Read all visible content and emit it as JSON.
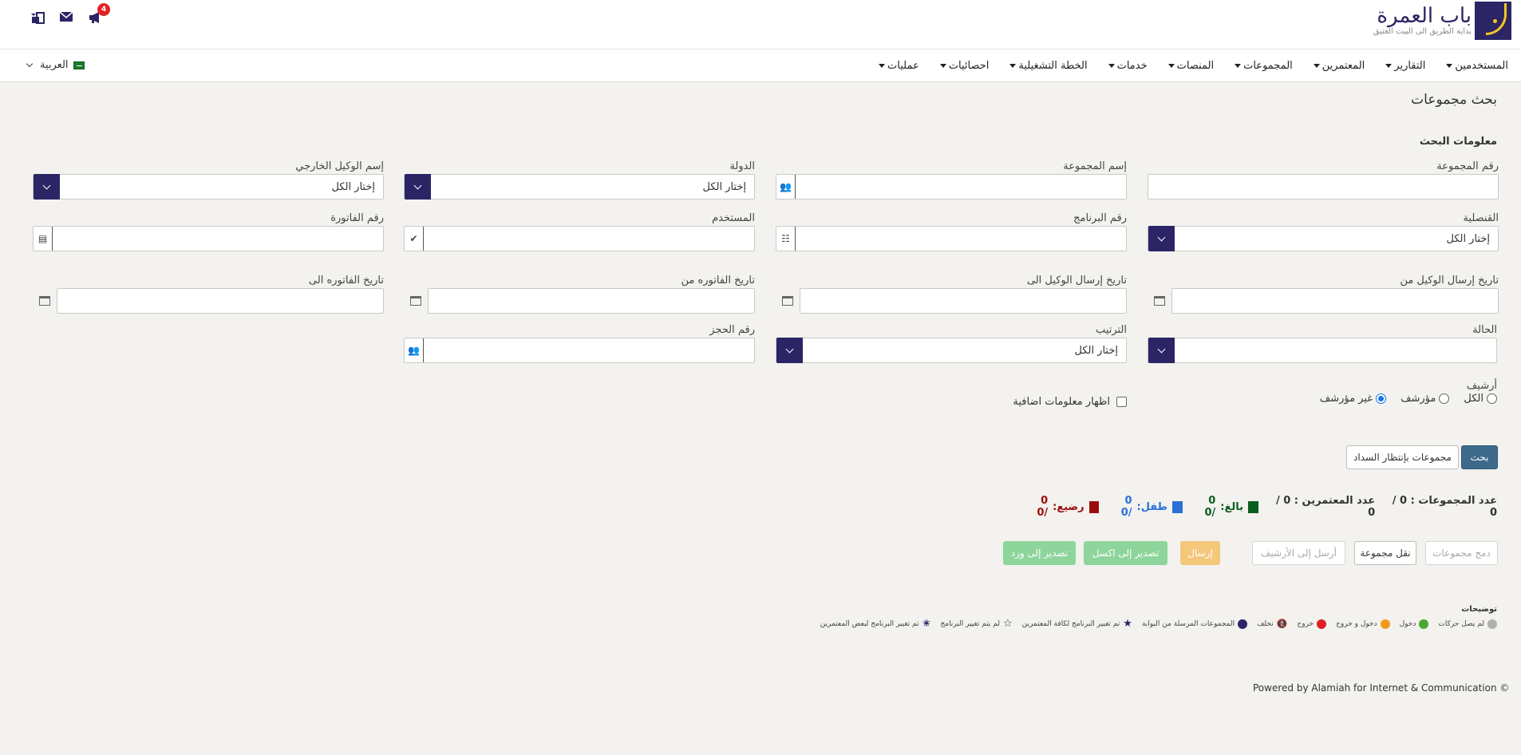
{
  "header": {
    "logo_title": "باب العمرة",
    "logo_subtitle": "بداية الطريق الى البيت العتيق",
    "notification_count": "4"
  },
  "nav": {
    "items": [
      "المستخدمين",
      "التقارير",
      "المعتمرين",
      "المجموعات",
      "المنصات",
      "خدمات",
      "الخطة التشغيلية",
      "احصائيات",
      "عمليات"
    ],
    "language": "العربية"
  },
  "page": {
    "title": "بحث مجموعات",
    "section": "معلومات البحث"
  },
  "form": {
    "group_number": {
      "label": "رقم المجموعة",
      "value": ""
    },
    "group_name": {
      "label": "إسم المجموعة",
      "value": ""
    },
    "country": {
      "label": "الدولة",
      "value": "إختار الكل"
    },
    "external_agent": {
      "label": "إسم الوكيل الخارجي",
      "value": "إختار الكل"
    },
    "consulate": {
      "label": "القنصلية",
      "value": "إختار الكل"
    },
    "program_number": {
      "label": "رقم البرنامج",
      "value": ""
    },
    "user": {
      "label": "المستخدم",
      "value": ""
    },
    "invoice_number": {
      "label": "رقم الفاتورة",
      "value": ""
    },
    "agent_send_from": {
      "label": "تاريخ إرسال الوكيل من",
      "value": ""
    },
    "agent_send_to": {
      "label": "تاريخ إرسال الوكيل الى",
      "value": ""
    },
    "invoice_date_from": {
      "label": "تاريخ الفاتوره من",
      "value": ""
    },
    "invoice_date_to": {
      "label": "تاريخ الفاتوره الى",
      "value": ""
    },
    "status": {
      "label": "الحالة",
      "value": ""
    },
    "sort": {
      "label": "الترتيب",
      "value": "إختار الكل"
    },
    "booking_number": {
      "label": "رقم الحجز",
      "value": ""
    },
    "archive": {
      "label": "أرشيف",
      "options": [
        "الكل",
        "مؤرشف",
        "غير مؤرشف"
      ],
      "selected": "غير مؤرشف"
    },
    "extra_info_label": "اظهار معلومات اضافية"
  },
  "actions": {
    "search": "بحث",
    "pending_payment": "مجموعات بإنتظار السداد",
    "merge": "دمج مجموعات",
    "move": "نقل مجموعة",
    "archive": "أرسل إلى الأرشيف",
    "send": "إرسال",
    "export_excel": "تصدير إلى اكسل",
    "export_word": "تصدير إلى ورد"
  },
  "stats": {
    "groups_label": "عدد المجموعات :",
    "groups_value": "0 / 0",
    "pilgrims_label": "عدد المعتمرين :",
    "pilgrims_value": "0 / 0",
    "adult_label": "بالغ:",
    "adult_value": "0 /0",
    "child_label": "طفل:",
    "child_value": "0 /0",
    "infant_label": "رضيع:",
    "infant_value": "0 /0",
    "colors": {
      "adult": "#0b5d1e",
      "child": "#2b6fd8",
      "infant": "#9b0d0d"
    }
  },
  "legend": {
    "title": "توضيحات",
    "items": [
      {
        "label": "لم يصل حركات",
        "icon": "gray-dot-icon",
        "color": "#b0b0b0"
      },
      {
        "label": "دخول",
        "icon": "green-dot-icon",
        "color": "#4aa832"
      },
      {
        "label": "دخول و خروج",
        "icon": "orange-dot-icon",
        "color": "#f19a1b"
      },
      {
        "label": "خروج",
        "icon": "red-dot-icon",
        "color": "#e02020"
      },
      {
        "label": "تخلف",
        "icon": "runner-icon",
        "color": "#c0392b"
      },
      {
        "label": "المجموعات المرسلة من البوابة",
        "icon": "globe-icon",
        "color": "#2b2565"
      },
      {
        "label": "تم تغيير البرنامج لكافة المعتمرين",
        "icon": "star-filled-icon",
        "color": "#2b2565"
      },
      {
        "label": "لم يتم تغيير البرنامج",
        "icon": "star-outline-icon",
        "color": "#2b2565"
      },
      {
        "label": "تم تغيير البرنامج لبعض المعتمرين",
        "icon": "star-half-icon",
        "color": "#2b2565"
      }
    ]
  },
  "footer": {
    "text": "Powered by Alamiah for Internet & Communication ©"
  }
}
